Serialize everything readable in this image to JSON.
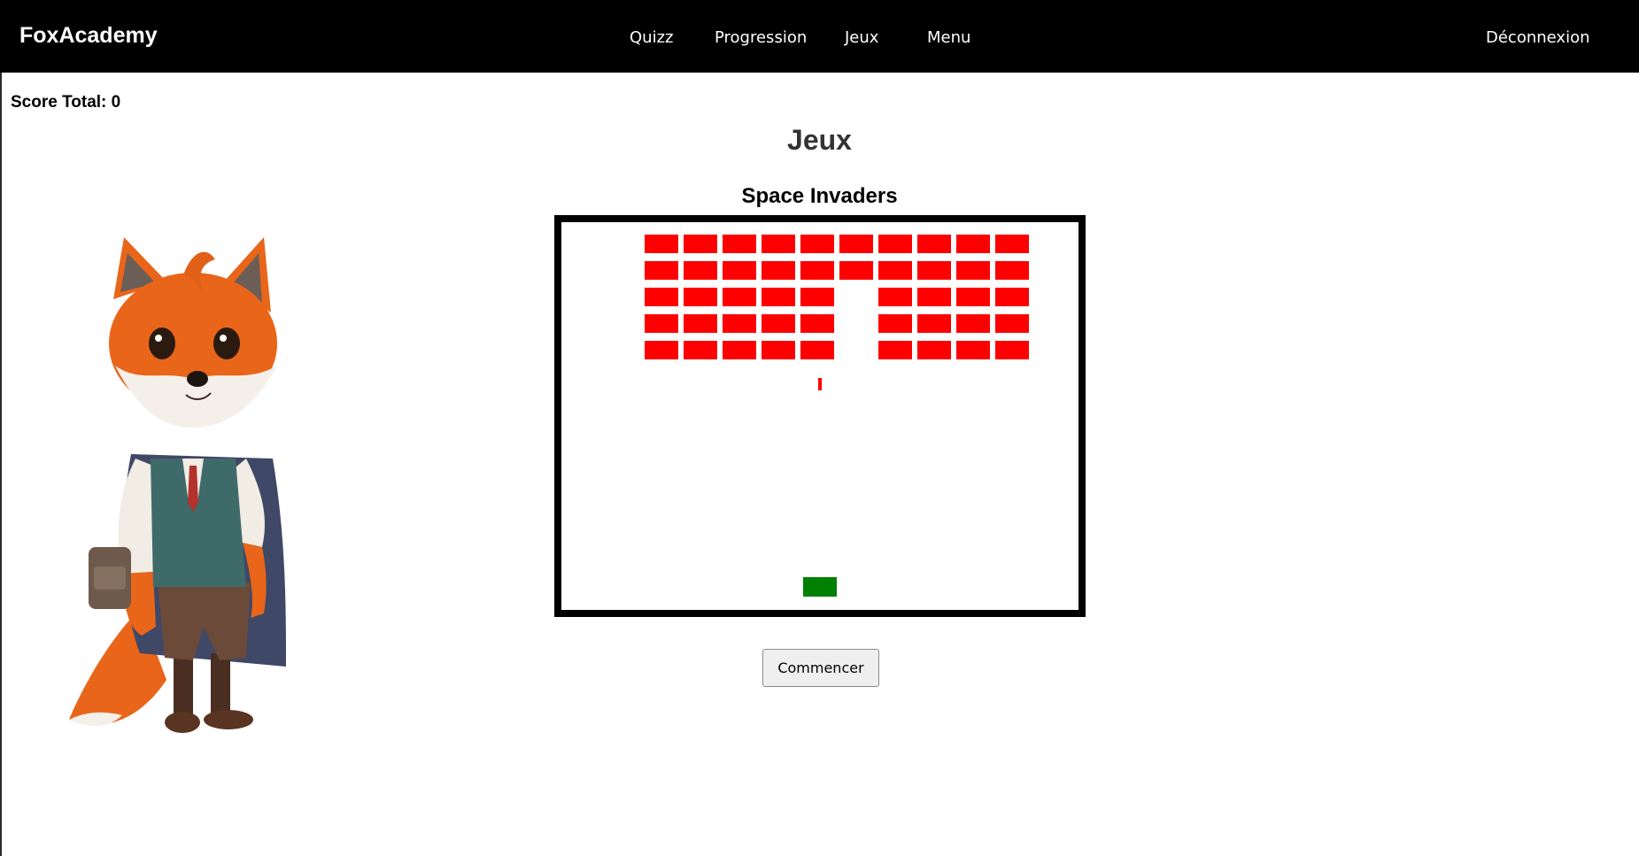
{
  "navbar": {
    "brand": "FoxAcademy",
    "links": [
      "Quizz",
      "Progression",
      "Jeux",
      "Menu"
    ],
    "logout": "Déconnexion"
  },
  "score": {
    "label": "Score Total: 0"
  },
  "page": {
    "title": "Jeux"
  },
  "game": {
    "title": "Space Invaders",
    "start_button": "Commencer",
    "invader_grid": {
      "columns": 10,
      "rows": 5,
      "missing": [
        [
          3,
          5
        ],
        [
          4,
          5
        ],
        [
          2,
          5
        ]
      ],
      "color": "#ff0000"
    },
    "player_color": "#008000",
    "bullet_color": "#ff0000"
  },
  "colors": {
    "navbar_bg": "#000000",
    "board_border": "#000000"
  },
  "images": {
    "mascot": "fox-student-illustration"
  }
}
